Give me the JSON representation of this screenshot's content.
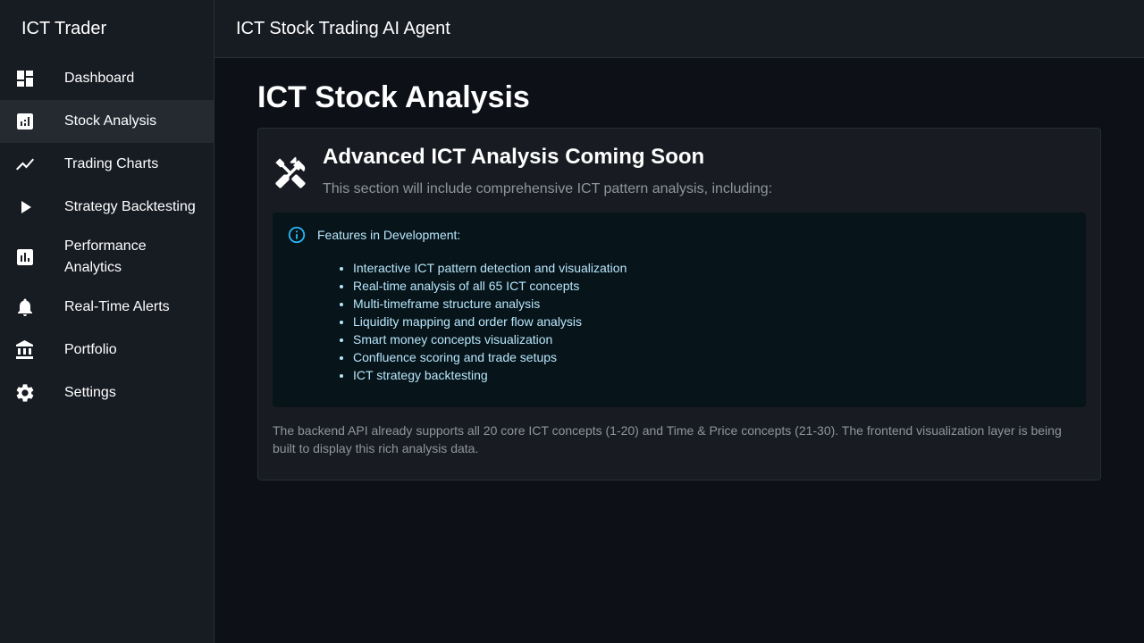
{
  "sidebar": {
    "brand": "ICT Trader",
    "items": [
      {
        "label": "Dashboard",
        "icon": "dashboard-icon"
      },
      {
        "label": "Stock Analysis",
        "icon": "analytics-icon"
      },
      {
        "label": "Trading Charts",
        "icon": "trend-line-icon"
      },
      {
        "label": "Strategy Backtesting",
        "icon": "play-icon"
      },
      {
        "label": "Performance Analytics",
        "icon": "bar-chart-icon"
      },
      {
        "label": "Real-Time Alerts",
        "icon": "bell-icon"
      },
      {
        "label": "Portfolio",
        "icon": "bank-icon"
      },
      {
        "label": "Settings",
        "icon": "gear-icon"
      }
    ],
    "active_item": "Stock Analysis"
  },
  "appbar": {
    "title": "ICT Stock Trading AI Agent"
  },
  "main": {
    "page_title": "ICT Stock Analysis",
    "card": {
      "icon": "tools-icon",
      "title": "Advanced ICT Analysis Coming Soon",
      "subtitle": "This section will include comprehensive ICT pattern analysis, including:",
      "alert": {
        "icon": "info-icon",
        "title": "Features in Development:",
        "features": [
          "Interactive ICT pattern detection and visualization",
          "Real-time analysis of all 65 ICT concepts",
          "Multi-timeframe structure analysis",
          "Liquidity mapping and order flow analysis",
          "Smart money concepts visualization",
          "Confluence scoring and trade setups",
          "ICT strategy backtesting"
        ]
      },
      "footnote": "The backend API already supports all 20 core ICT concepts (1-20) and Time & Price concepts (21-30). The frontend visualization layer is being built to display this rich analysis data."
    }
  },
  "colors": {
    "background": "#0d1117",
    "surface": "#171b22",
    "info_accent": "#29b6f6",
    "muted_text": "#8f959c"
  }
}
